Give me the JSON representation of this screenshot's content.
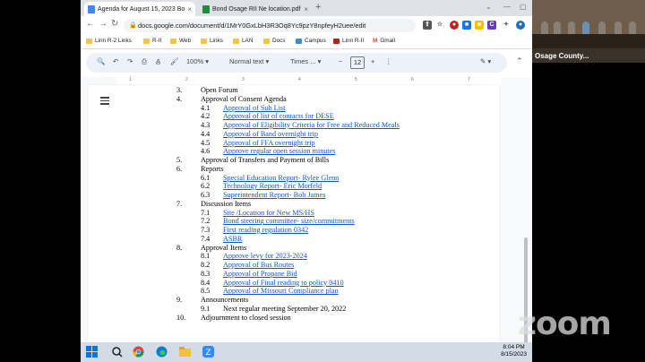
{
  "browser": {
    "tabs": [
      {
        "title": "Agenda for August 15, 2023 Bo",
        "active": true
      },
      {
        "title": "Bond Osage RII Ne location.pdf",
        "active": false
      }
    ],
    "url": "docs.google.com/document/d/1MrY0GxLbH3R3Oq8Yc9pzY8npfeyH2uee/edit",
    "bookmarks": [
      "Linn R-2 Links",
      "R-II",
      "Web",
      "Links",
      "LAN",
      "Docs",
      "Campus",
      "Linn R-II",
      "Gmail"
    ]
  },
  "docs_toolbar": {
    "zoom": "100%",
    "style": "Normal text",
    "font": "Times ...",
    "font_size": "12"
  },
  "ruler_numbers": [
    "1",
    "2",
    "3",
    "4",
    "5",
    "6",
    "7"
  ],
  "agenda": [
    {
      "type": "top",
      "num": "3.",
      "text": "Open Forum"
    },
    {
      "type": "top",
      "num": "4.",
      "text": "Approval of Consent Agenda"
    },
    {
      "type": "sub",
      "num": "4.1",
      "text": "Approval of Sub List",
      "link": true
    },
    {
      "type": "sub",
      "num": "4.2",
      "text": "Approval of list of contacts for DESE",
      "link": true
    },
    {
      "type": "sub",
      "num": "4.3",
      "text": "Approval of Eligibility Criteria for Free and Reduced Meals",
      "link": true
    },
    {
      "type": "sub",
      "num": "4.4",
      "text": "Approval of Band overnight trip",
      "link": true
    },
    {
      "type": "sub",
      "num": "4.5",
      "text": "Approval of FFA overnight trip",
      "link": true
    },
    {
      "type": "sub",
      "num": "4.6",
      "text": "Approve regular open session minutes",
      "link": true
    },
    {
      "type": "top",
      "num": "5.",
      "text": "Approval of Transfers and Payment of Bills"
    },
    {
      "type": "top",
      "num": "6.",
      "text": "Reports"
    },
    {
      "type": "sub",
      "num": "6.1",
      "text": "Special Education Report- Rylee Glenn",
      "link": true
    },
    {
      "type": "sub",
      "num": "6.2",
      "text": "Technology Report- Eric Morfeld",
      "link": true
    },
    {
      "type": "sub",
      "num": "6.3",
      "text": "Superintendent Report- Bob James",
      "link": true
    },
    {
      "type": "top",
      "num": "7.",
      "text": "Discussion Items"
    },
    {
      "type": "sub",
      "num": "7.1",
      "text": "Site /Location for New MS/HS",
      "link": true
    },
    {
      "type": "sub",
      "num": "7.2",
      "text": "Bond steering committee- size/commitments",
      "link": true
    },
    {
      "type": "sub",
      "num": "7.3",
      "text": "First reading regulation 0342",
      "link": true
    },
    {
      "type": "sub",
      "num": "7.4",
      "text": "ASBR",
      "link": true
    },
    {
      "type": "top",
      "num": "8.",
      "text": "Approval Items"
    },
    {
      "type": "sub",
      "num": "8.1",
      "text": "Approve levy for 2023-2024",
      "link": true
    },
    {
      "type": "sub",
      "num": "8.2",
      "text": "Approval of Bus Routes",
      "link": true
    },
    {
      "type": "sub",
      "num": "8.3",
      "text": "Approval of Propane Bid",
      "link": true
    },
    {
      "type": "sub",
      "num": "8.4",
      "text": "Approval of Final reading to policy 0410",
      "link": true
    },
    {
      "type": "sub",
      "num": "8.5",
      "text": "Approval of Missouri Compliance plan",
      "link": true
    },
    {
      "type": "top",
      "num": "9.",
      "text": "Announcements"
    },
    {
      "type": "sub",
      "num": "9.1",
      "text": "Next regular meeting September 20, 2022",
      "link": false
    },
    {
      "type": "top",
      "num": "10.",
      "text": "Adjournment to closed session"
    }
  ],
  "taskbar": {
    "time": "8:04 PM",
    "date": "8/15/2023"
  },
  "side_video": {
    "label": "Osage County..."
  },
  "zoom_watermark": "zoom",
  "colors": {
    "link": "#1155cc",
    "docs_toolbar_bg": "#edf2fa",
    "tabstrip_bg": "#dee1e6"
  }
}
